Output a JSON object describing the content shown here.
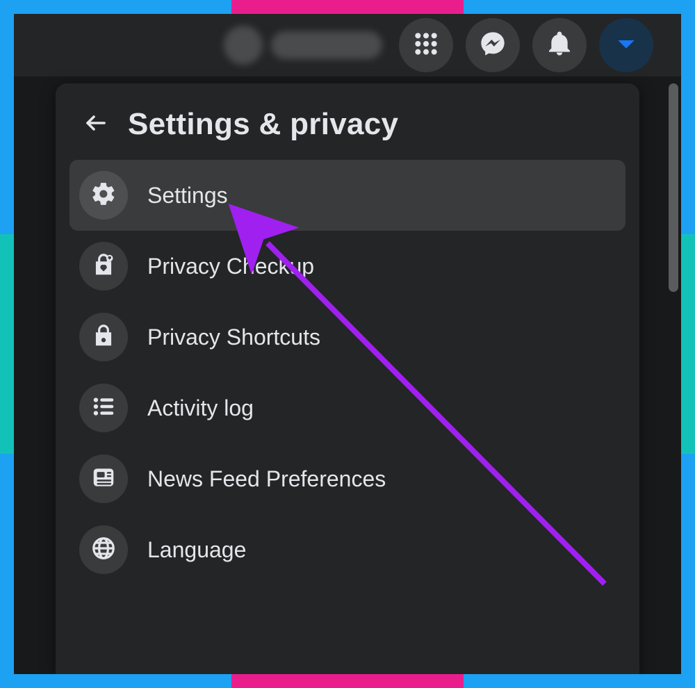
{
  "colors": {
    "accent_arrow": "#a020f0",
    "icon_fill": "#e4e6eb",
    "menu_highlight": "#3a3b3c",
    "caret_blue": "#1877f2"
  },
  "topbar": {
    "buttons": {
      "grid_icon": "menu-grid",
      "messenger_icon": "messenger",
      "bell_icon": "notifications",
      "caret_icon": "account-dropdown"
    }
  },
  "panel": {
    "title": "Settings & privacy",
    "back_label": "Back",
    "items": [
      {
        "id": "settings",
        "label": "Settings",
        "icon": "gear",
        "hover": true
      },
      {
        "id": "privacy-checkup",
        "label": "Privacy Checkup",
        "icon": "lock-heart",
        "hover": false
      },
      {
        "id": "privacy-shortcuts",
        "label": "Privacy Shortcuts",
        "icon": "lock",
        "hover": false
      },
      {
        "id": "activity-log",
        "label": "Activity log",
        "icon": "list",
        "hover": false
      },
      {
        "id": "news-feed-prefs",
        "label": "News Feed Preferences",
        "icon": "newspaper",
        "hover": false
      },
      {
        "id": "language",
        "label": "Language",
        "icon": "globe",
        "hover": false
      }
    ]
  }
}
